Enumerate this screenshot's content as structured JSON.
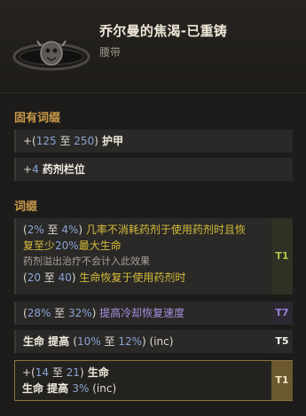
{
  "item": {
    "name": "乔尔曼的焦渴-已重铸",
    "type": "腰带"
  },
  "sections": {
    "implicit_title": "固有词缀",
    "affix_title": "词缀"
  },
  "implicit": [
    {
      "prefix": "+(",
      "a": "125",
      "mid": " 至 ",
      "b": "250",
      "close": ")",
      "label": " 护甲"
    },
    {
      "prefix": "+",
      "a": "4",
      "label": " 药剂栏位"
    }
  ],
  "affixes": {
    "a1": {
      "lead": "(",
      "a": "2%",
      "mid": " 至 ",
      "b": "4%",
      "close": ")",
      "text1": " 几率不消耗药剂于使用药剂时且恢",
      "text2a": "复至少",
      "text2b": "20%",
      "text2c": "最大生命",
      "note": "药剂溢出治疗不会计入此效果",
      "l3a": "(",
      "l3b": "20",
      "l3c": " 至 ",
      "l3d": "40",
      "l3e": ")",
      "l3text": " 生命恢复于使用药剂时",
      "tier": "T1"
    },
    "a2": {
      "lead": "(",
      "a": "28%",
      "mid": " 至 ",
      "b": "32%",
      "close": ")",
      "text": " 提高冷却恢复速度",
      "tier": "T7"
    },
    "a3": {
      "t1": "生命 提高 ",
      "lead": "(",
      "a": "10%",
      "mid": " 至 ",
      "b": "12%",
      "close": ")",
      "suffix": " (inc)",
      "tier": "T5"
    },
    "a4": {
      "l1a": "+(",
      "l1b": "14",
      "l1c": " 至 ",
      "l1d": "21",
      "l1e": ")",
      "l1text": " 生命",
      "l2a": "生命 提高 ",
      "l2b": "3%",
      "l2c": " (inc)",
      "tier": "T1"
    }
  }
}
